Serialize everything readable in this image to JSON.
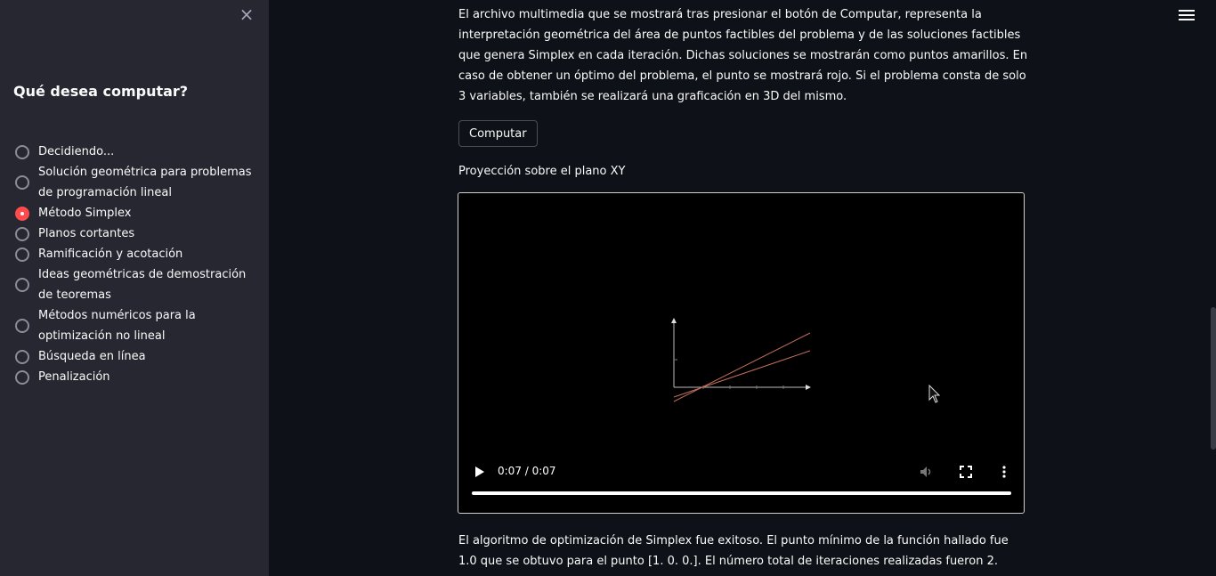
{
  "sidebar": {
    "close_icon": "×",
    "question": "Qué desea computar?",
    "options": [
      {
        "label": "Decidiendo...",
        "selected": false
      },
      {
        "label": "Solución geométrica para problemas de programación lineal",
        "selected": false
      },
      {
        "label": "Método Simplex",
        "selected": true
      },
      {
        "label": "Planos cortantes",
        "selected": false
      },
      {
        "label": "Ramificación y acotación",
        "selected": false
      },
      {
        "label": "Ideas geométricas de demostración de teoremas",
        "selected": false
      },
      {
        "label": "Métodos numéricos para la optimización no lineal",
        "selected": false
      },
      {
        "label": "Búsqueda en línea",
        "selected": false
      },
      {
        "label": "Penalización",
        "selected": false
      }
    ],
    "accent_color": "#ff4b4b"
  },
  "main": {
    "description": "El archivo multimedia que se mostrará tras presionar el botón de Computar, representa la interpretación geométrica del área de puntos factibles del problema y de las soluciones factibles que genera Simplex en cada iteración. Dichas soluciones se mostrarán como puntos amarillos. En caso de obtener un óptimo del problema, el punto se mostrará rojo. Si el problema consta de solo 3 variables, también se realizará una graficación en 3D del mismo.",
    "compute_button": "Computar",
    "projection_label": "Proyección sobre el plano XY",
    "video": {
      "time": "0:07 / 0:07",
      "progress": 1.0
    },
    "result": "El algoritmo de optimización de Simplex fue exitoso. El punto mínimo de la función hallado fue 1.0 que se obtuvo para el punto [1. 0. 0.]. El número total de iteraciones realizadas fueron 2."
  }
}
